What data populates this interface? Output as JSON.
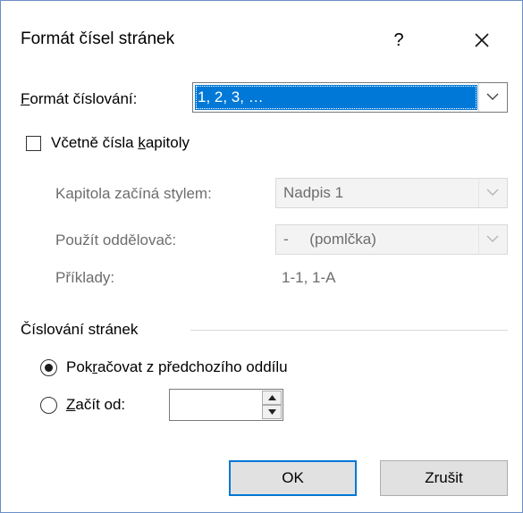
{
  "dialog": {
    "title": "Formát čísel stránek",
    "help_label": "?",
    "close_icon": "close-icon"
  },
  "format": {
    "label_accel": "F",
    "label_rest": "ormát číslování:",
    "selected": "1, 2, 3, …"
  },
  "chapter": {
    "include_label_pre": "Včetně čísla ",
    "include_label_accel": "k",
    "include_label_post": "apitoly",
    "include_checked": false,
    "style_label": "Kapitola začíná stylem:",
    "style_value": "Nadpis 1",
    "separator_label": "Použít oddělovač:",
    "separator_value": "-     (pomlčka)",
    "examples_label": "Příklady:",
    "examples_value": "1-1, 1-A"
  },
  "numbering": {
    "group_label": "Číslování stránek",
    "continue_pre": "Pok",
    "continue_accel": "r",
    "continue_post": "ačovat z předchozího oddílu",
    "continue_selected": true,
    "start_accel": "Z",
    "start_rest": "ačít od:",
    "start_selected": false,
    "start_value": ""
  },
  "buttons": {
    "ok": "OK",
    "cancel": "Zrušit"
  }
}
